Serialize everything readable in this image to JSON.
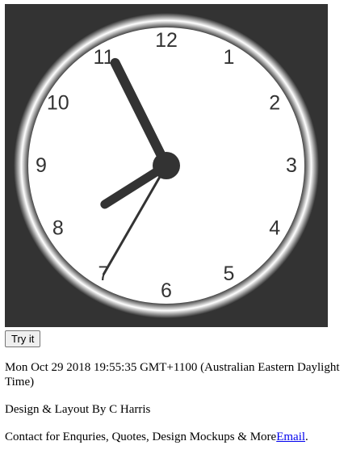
{
  "clock": {
    "numbers": [
      "12",
      "1",
      "2",
      "3",
      "4",
      "5",
      "6",
      "7",
      "8",
      "9",
      "10",
      "11"
    ],
    "time": {
      "hour": 19,
      "minute": 55,
      "second": 35
    },
    "colors": {
      "background": "#333333",
      "face": "#ffffff",
      "rim_dark": "#333333",
      "rim_light": "#ffffff",
      "hands": "#333333"
    }
  },
  "button": {
    "label": "Try it"
  },
  "date_text": "Mon Oct 29 2018 19:55:35 GMT+1100 (Australian Eastern Daylight Time)",
  "credit_text": "Design & Layout By C Harris",
  "contact": {
    "text": "Contact for Enquries, Quotes, Design Mockups & More",
    "link_label": "Email",
    "trailing": "."
  }
}
